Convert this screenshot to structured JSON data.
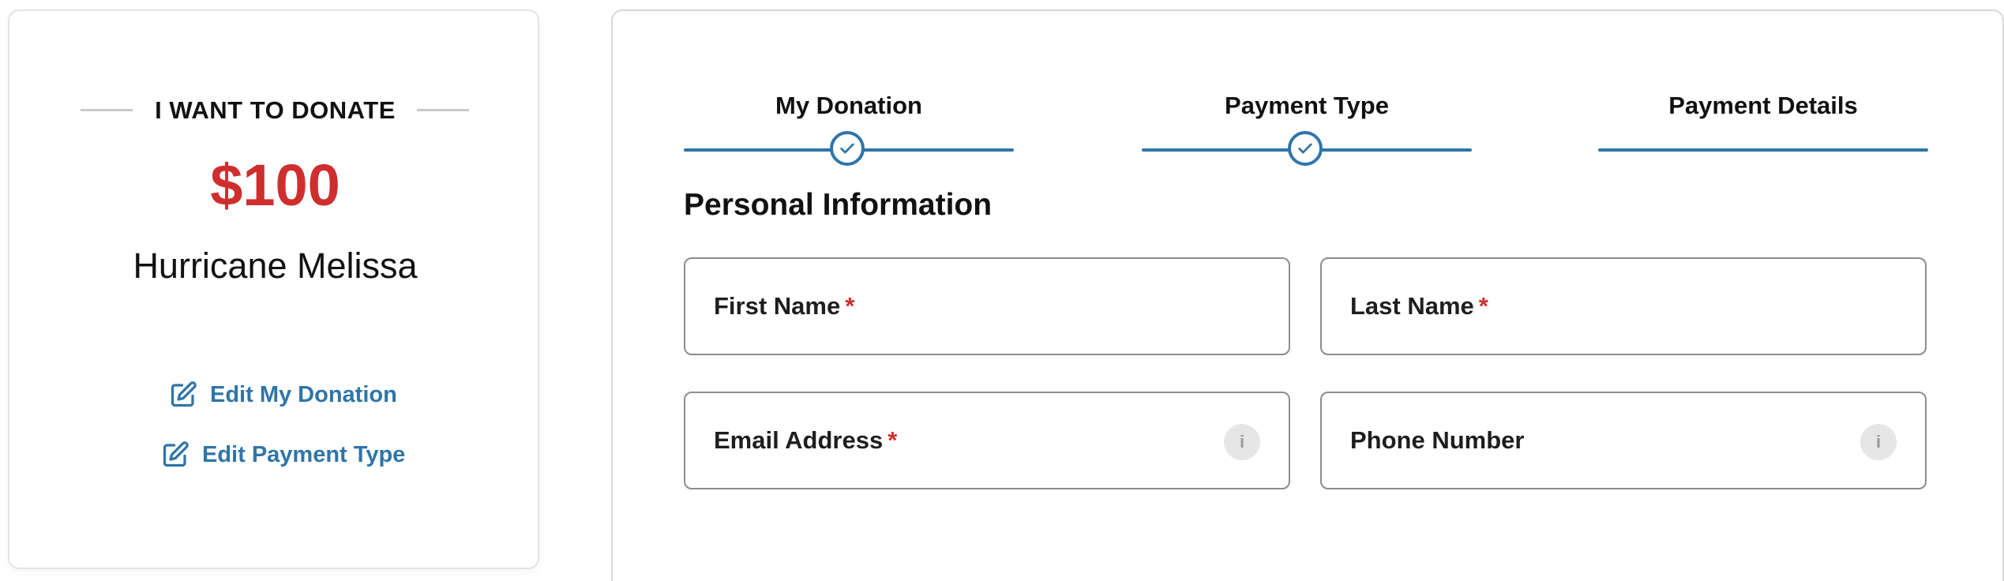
{
  "summary": {
    "heading": "I WANT TO DONATE",
    "amount": "$100",
    "campaign": "Hurricane Melissa",
    "edit_donation_label": "Edit My Donation",
    "edit_payment_label": "Edit Payment Type"
  },
  "steps": [
    {
      "label": "My Donation",
      "status": "complete",
      "icon": "check-icon"
    },
    {
      "label": "Payment Type",
      "status": "complete",
      "icon": "check-icon"
    },
    {
      "label": "Payment Details",
      "status": "current"
    }
  ],
  "form": {
    "section_title": "Personal Information",
    "required_marker": "*",
    "fields": {
      "first_name": {
        "label": "First Name",
        "required": true,
        "value": ""
      },
      "last_name": {
        "label": "Last Name",
        "required": true,
        "value": ""
      },
      "email": {
        "label": "Email Address",
        "required": true,
        "value": "",
        "info_icon": "info-icon"
      },
      "phone": {
        "label": "Phone Number",
        "required": false,
        "value": "",
        "info_icon": "info-icon"
      }
    },
    "info_glyph": "i"
  },
  "colors": {
    "accent_blue": "#2f75a8",
    "amount_red": "#cf2e2e",
    "required_red": "#cf2e2e",
    "field_border": "#8d8d8d"
  }
}
